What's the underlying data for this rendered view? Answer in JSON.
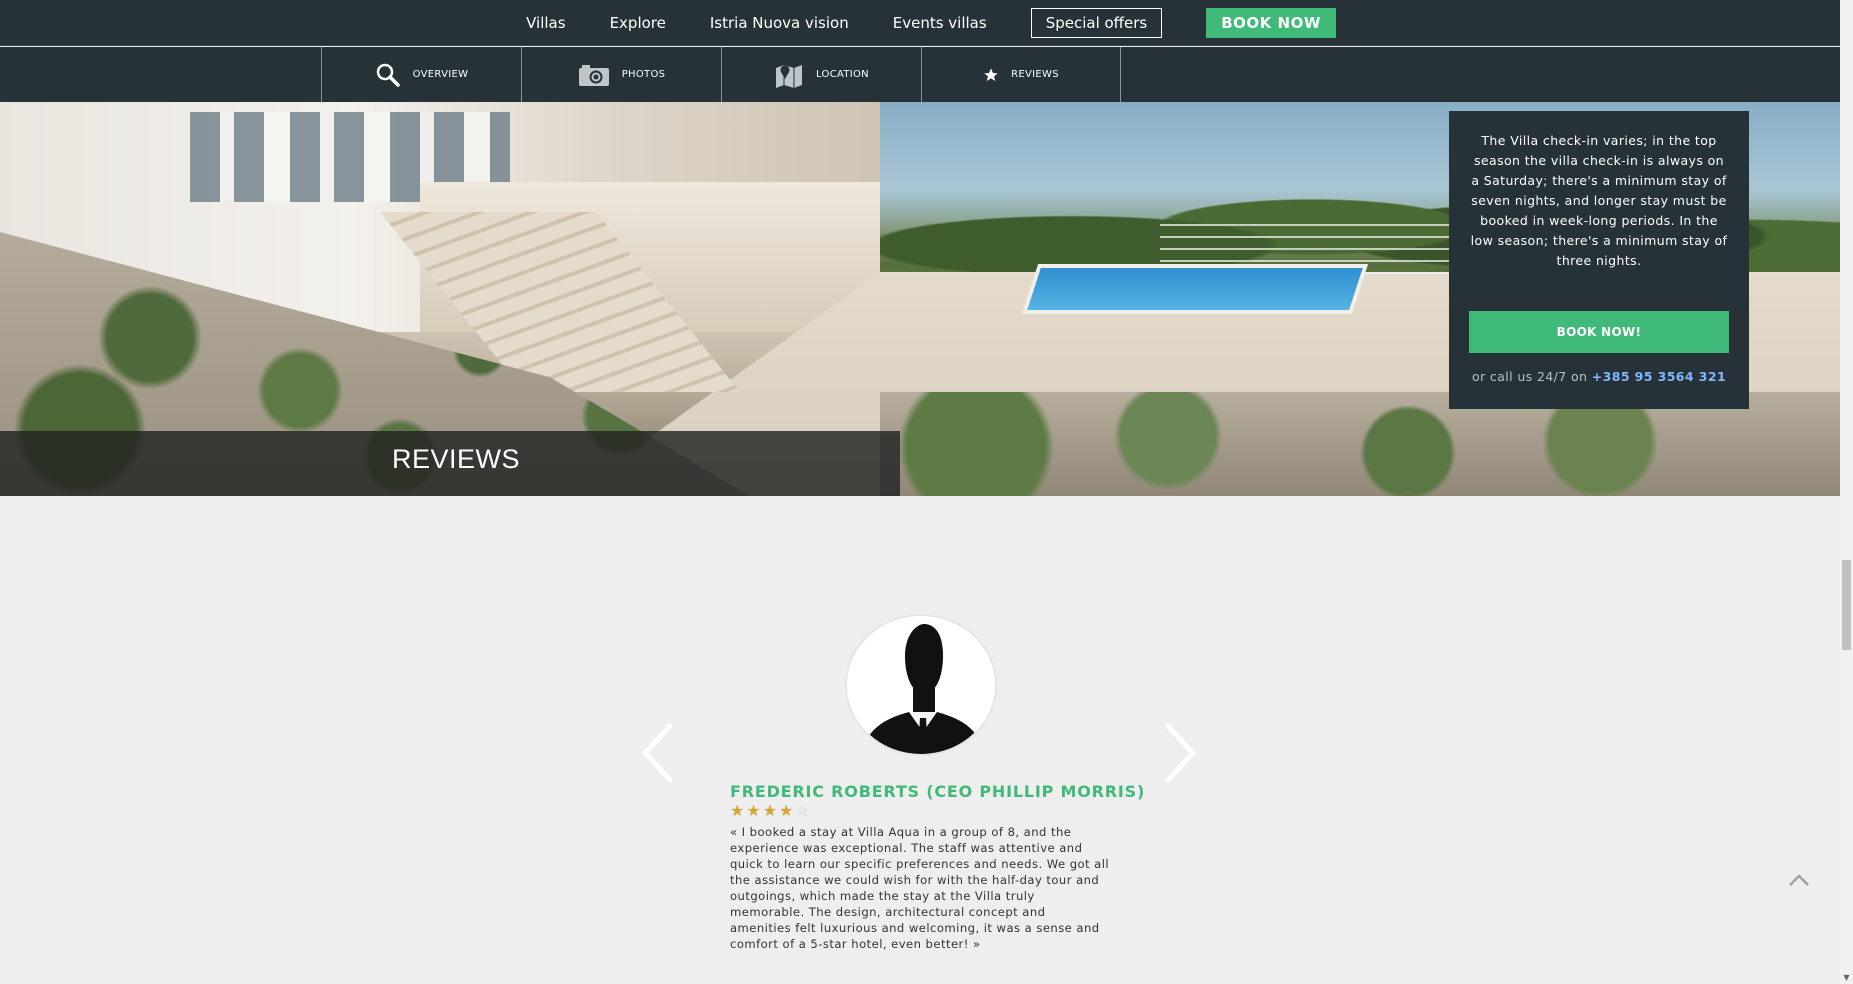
{
  "topnav": {
    "links": [
      "Villas",
      "Explore",
      "Istria Nuova vision",
      "Events villas"
    ],
    "special_offers": "Special offers",
    "book_now": "BOOK NOW"
  },
  "subnav": {
    "tabs": [
      {
        "label": "OVERVIEW",
        "icon": "magnifier-icon"
      },
      {
        "label": "PHOTOS",
        "icon": "camera-icon"
      },
      {
        "label": "LOCATION",
        "icon": "map-icon"
      },
      {
        "label": "REVIEWS",
        "icon": "star-icon"
      }
    ]
  },
  "hero": {
    "section_title": "REVIEWS"
  },
  "booking": {
    "info": "The Villa check-in varies; in the top season the villa check-in is always on a Saturday; there's a minimum stay of seven nights, and longer stay must be booked in week-long periods. In the low season; there's a minimum stay of three nights.",
    "button": "BOOK NOW!",
    "call_prefix": "or call us 24/7 on",
    "phone": "+385 95 3564 321"
  },
  "review": {
    "name": "FREDERIC ROBERTS (CEO PHILLIP MORRIS)",
    "rating": 4,
    "max_rating": 5,
    "text": "« I booked a stay at Villa Aqua in a group of 8, and the experience was exceptional. The staff was attentive and quick to learn our specific preferences and needs. We got all the assistance we could wish for with the half-day tour and outgoings, which made the stay at the Villa truly memorable. The design, architectural concept and amenities felt luxurious and welcoming, it was a sense and comfort of a 5-star hotel, even better! »"
  },
  "colors": {
    "nav_bg": "#263238",
    "accent_green": "#3fba78",
    "phone_blue": "#7fb8ff",
    "star_gold": "#d4a437",
    "page_bg": "#eeeeee"
  }
}
